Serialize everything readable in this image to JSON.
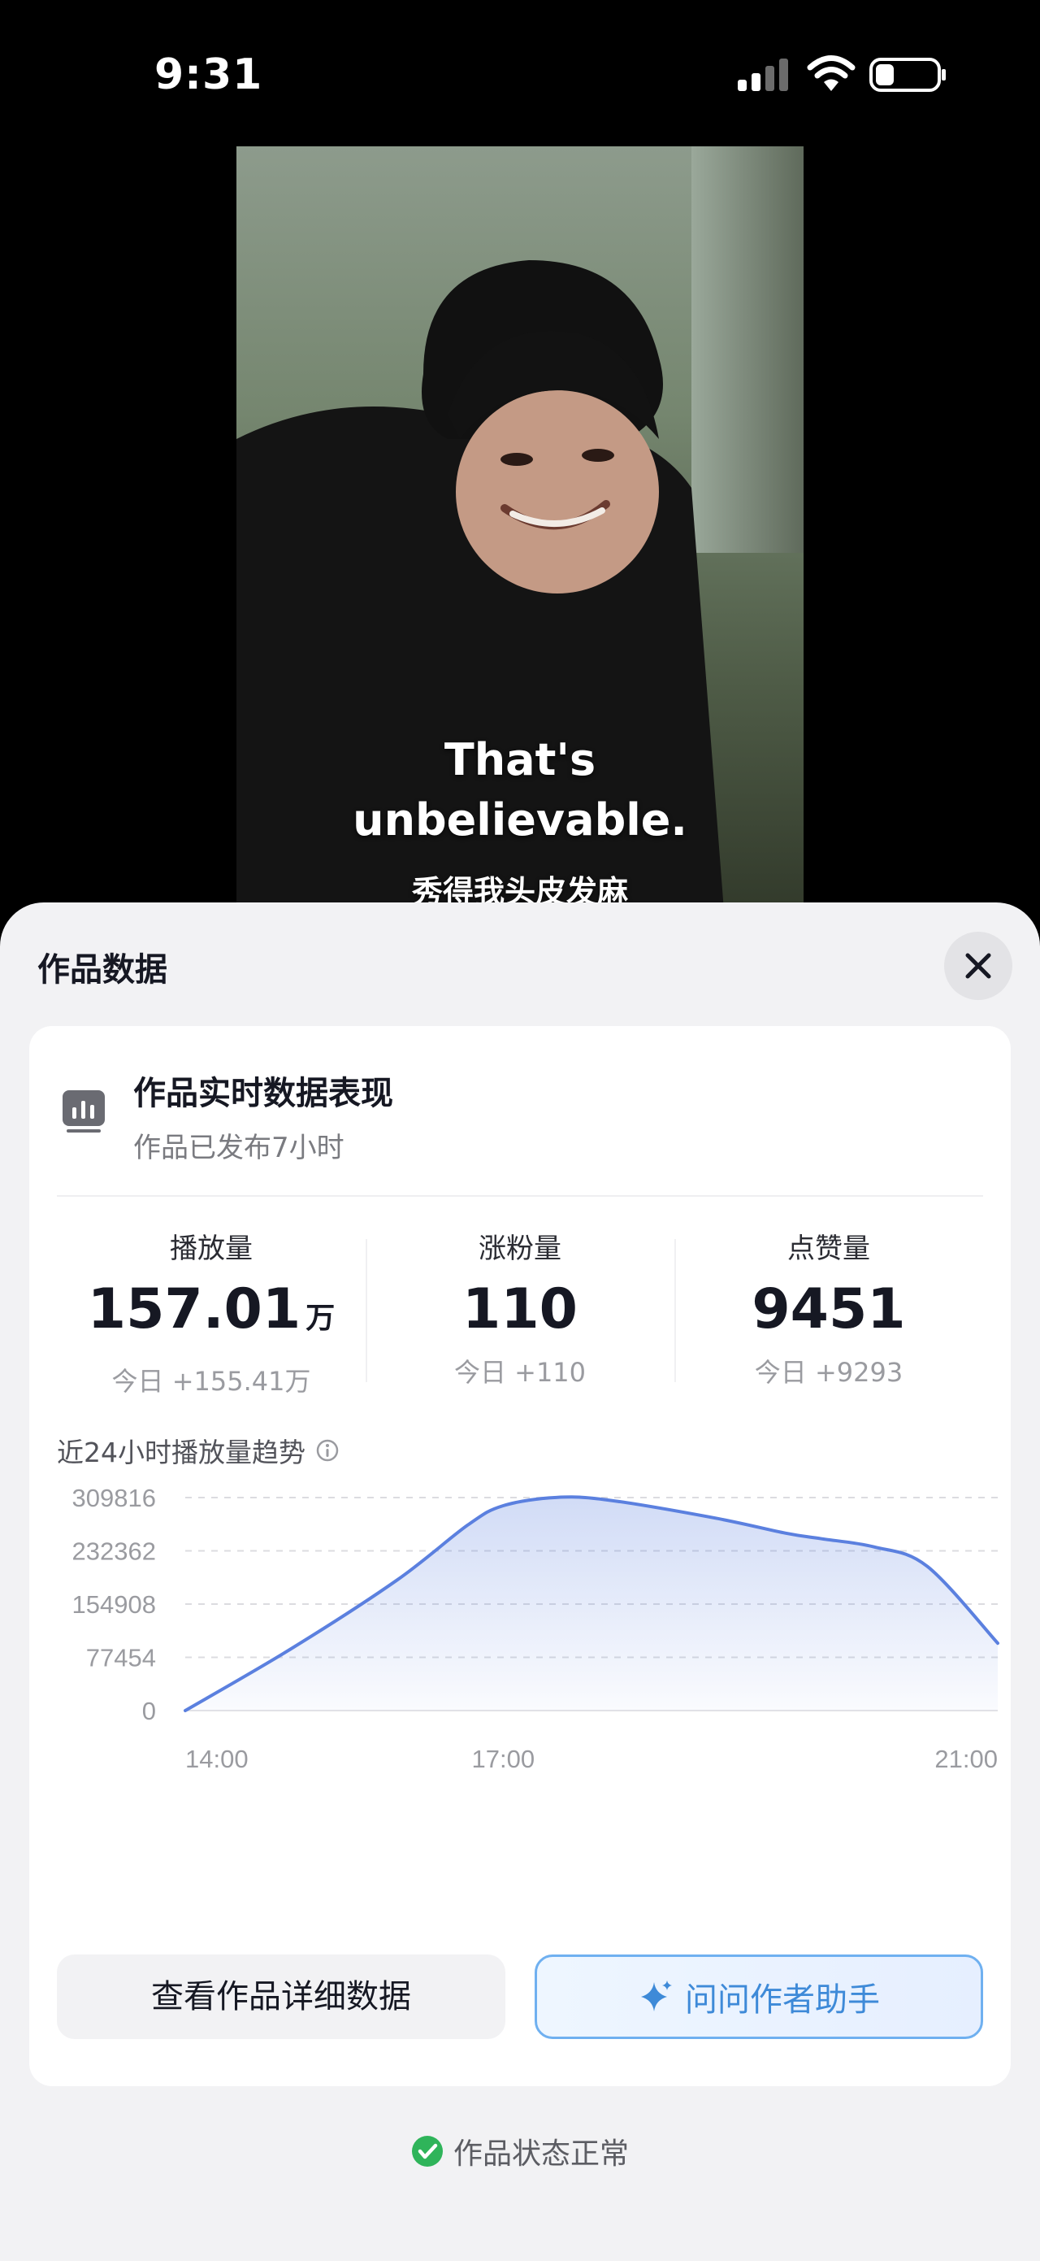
{
  "status_bar": {
    "time": "9:31",
    "icons": [
      "signal-icon",
      "wifi-icon",
      "battery-icon"
    ]
  },
  "video": {
    "caption_en_1": "That's",
    "caption_en_2": "unbelievable.",
    "caption_zh": "秀得我头皮发麻"
  },
  "sheet": {
    "title": "作品数据",
    "close_icon": "close-icon",
    "card": {
      "icon": "chart-icon",
      "title": "作品实时数据表现",
      "subtitle": "作品已发布7小时",
      "stats": [
        {
          "label": "播放量",
          "value": "157.01",
          "unit": "万",
          "today": "今日 +155.41万"
        },
        {
          "label": "涨粉量",
          "value": "110",
          "unit": "",
          "today": "今日 +110"
        },
        {
          "label": "点赞量",
          "value": "9451",
          "unit": "",
          "today": "今日 +9293"
        }
      ],
      "trend_title": "近24小时播放量趋势",
      "detail_button": "查看作品详细数据",
      "assistant_button": "问问作者助手"
    },
    "status_text": "作品状态正常"
  },
  "colors": {
    "line": "#5b80df",
    "accent": "#3e8ad8",
    "ok": "#2fb45a"
  },
  "chart_data": {
    "type": "area",
    "title": "",
    "xlabel": "",
    "ylabel": "",
    "x_ticks": [
      "14:00",
      "17:00",
      "21:00"
    ],
    "y_ticks": [
      "309816",
      "232362",
      "154908",
      "77454",
      "0"
    ],
    "ylim": [
      0,
      309816
    ],
    "xlim": [
      "14:00",
      "21:40"
    ],
    "grid": true,
    "x": [
      "14:00",
      "15:00",
      "16:00",
      "16:40",
      "17:00",
      "17:30",
      "18:00",
      "19:00",
      "19:40",
      "20:00",
      "20:30",
      "21:00",
      "21:40"
    ],
    "values": [
      0,
      90000,
      190000,
      270000,
      298000,
      310000,
      306000,
      280000,
      258000,
      250000,
      238000,
      210000,
      98000
    ]
  }
}
